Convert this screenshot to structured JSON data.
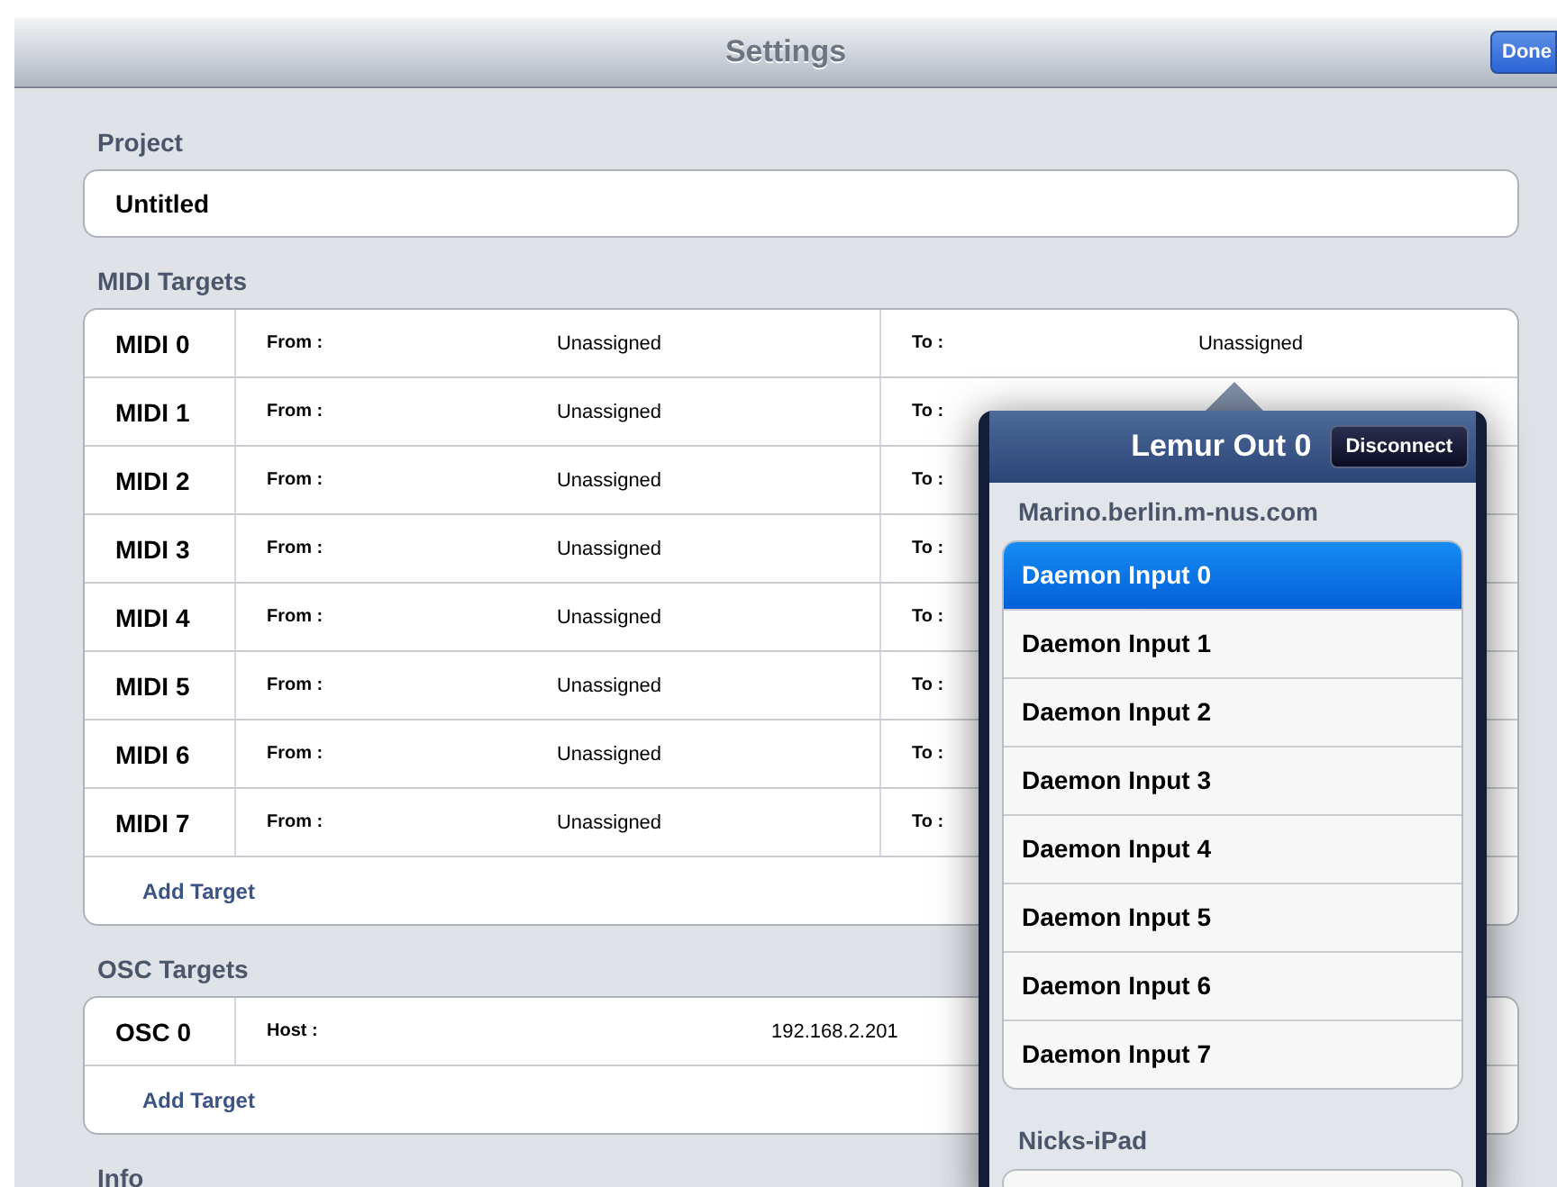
{
  "nav_bar": {
    "title": "Settings",
    "done_button": "Done"
  },
  "project": {
    "header": "Project",
    "name": "Untitled"
  },
  "midi_targets": {
    "header": "MIDI Targets",
    "add_button": "Add Target",
    "rows": [
      {
        "name": "MIDI 0",
        "from_label": "From :",
        "from_value": "Unassigned",
        "to_label": "To :",
        "to_value": "Unassigned"
      },
      {
        "name": "MIDI 1",
        "from_label": "From :",
        "from_value": "Unassigned",
        "to_label": "To :"
      },
      {
        "name": "MIDI 2",
        "from_label": "From :",
        "from_value": "Unassigned",
        "to_label": "To :"
      },
      {
        "name": "MIDI 3",
        "from_label": "From :",
        "from_value": "Unassigned",
        "to_label": "To :"
      },
      {
        "name": "MIDI 4",
        "from_label": "From :",
        "from_value": "Unassigned",
        "to_label": "To :"
      },
      {
        "name": "MIDI 5",
        "from_label": "From :",
        "from_value": "Unassigned",
        "to_label": "To :"
      },
      {
        "name": "MIDI 6",
        "from_label": "From :",
        "from_value": "Unassigned",
        "to_label": "To :"
      },
      {
        "name": "MIDI 7",
        "from_label": "From :",
        "from_value": "Unassigned",
        "to_label": "To :"
      }
    ]
  },
  "osc_targets": {
    "header": "OSC Targets",
    "add_button": "Add Target",
    "rows": [
      {
        "name": "OSC 0",
        "host_label": "Host :",
        "host_value": "192.168.2.201"
      }
    ]
  },
  "info": {
    "header": "Info"
  },
  "popover": {
    "title": "Lemur Out 0",
    "disconnect_button": "Disconnect",
    "groups": [
      {
        "host": "Marino.berlin.m-nus.com",
        "items": [
          {
            "label": "Daemon Input 0",
            "selected": true
          },
          {
            "label": "Daemon Input 1",
            "selected": false
          },
          {
            "label": "Daemon Input 2",
            "selected": false
          },
          {
            "label": "Daemon Input 3",
            "selected": false
          },
          {
            "label": "Daemon Input 4",
            "selected": false
          },
          {
            "label": "Daemon Input 5",
            "selected": false
          },
          {
            "label": "Daemon Input 6",
            "selected": false
          },
          {
            "label": "Daemon Input 7",
            "selected": false
          }
        ]
      },
      {
        "host": "Nicks-iPad"
      }
    ]
  }
}
